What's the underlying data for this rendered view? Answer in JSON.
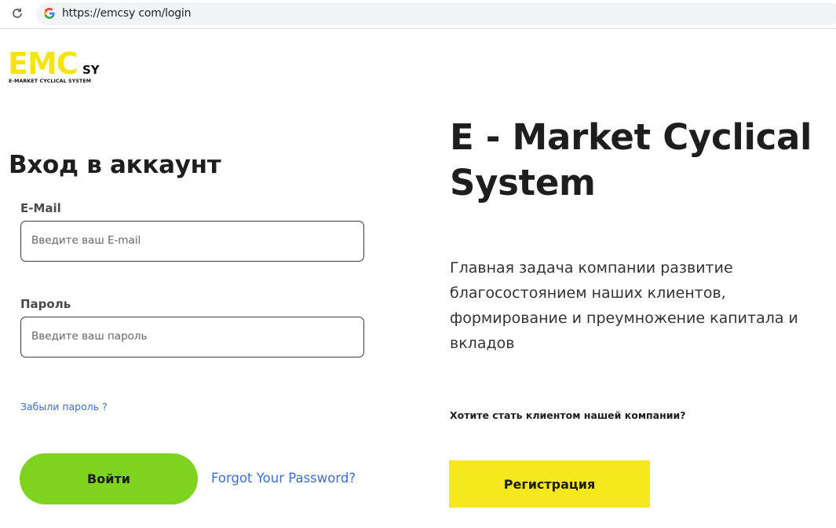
{
  "browser": {
    "url": "https://emcsy com/login"
  },
  "logo": {
    "main": "EMC",
    "suffix": "SY",
    "subtitle": "E-MARKET CYCLICAL SYSTEM"
  },
  "login": {
    "title": "Вход в аккаунт",
    "email_label": "E-Mail",
    "email_placeholder": "Введите ваш E-mail",
    "email_value": "",
    "password_label": "Пароль",
    "password_placeholder": "Введите ваш пароль",
    "password_value": "",
    "forgot_small": "Забыли пароль ?",
    "submit_label": "Войти",
    "forgot_link": "Forgot Your Password?"
  },
  "hero": {
    "title": "E - Market Cyclical System",
    "description": "Главная задача компании развитие благосостоянием наших клиентов, формирование и преумножение капитала и вкладов",
    "cta_question": "Хотите стать клиентом нашей компании?",
    "register_label": "Регистрация"
  },
  "colors": {
    "logo_yellow": "#f5e50f",
    "login_button": "#7ed321",
    "register_button": "#f7e81b",
    "link_blue": "#3d6ec9"
  }
}
